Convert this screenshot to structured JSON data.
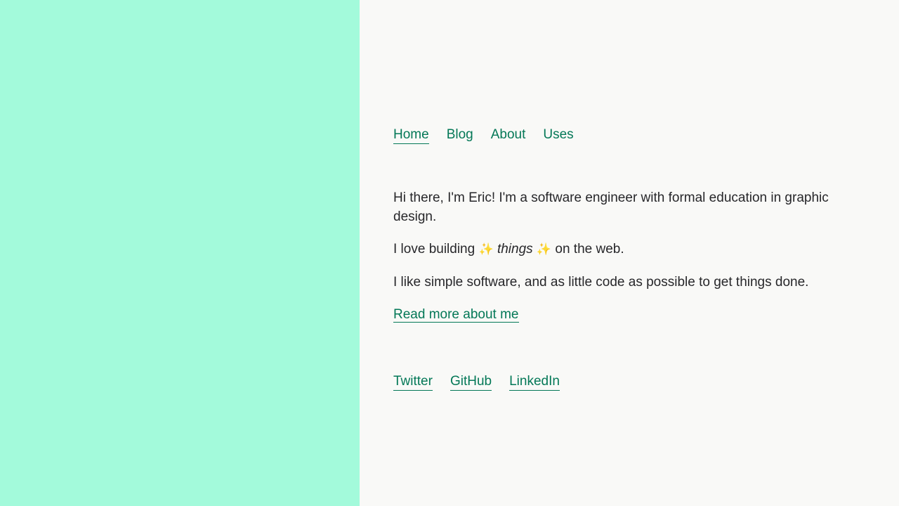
{
  "colors": {
    "left_panel": "#a3fadb",
    "page_bg": "#f9f9f7",
    "link": "#047857",
    "text": "#27272a",
    "sparkle": "#f6a821"
  },
  "nav": {
    "items": [
      {
        "label": "Home",
        "active": true
      },
      {
        "label": "Blog",
        "active": false
      },
      {
        "label": "About",
        "active": false
      },
      {
        "label": "Uses",
        "active": false
      }
    ]
  },
  "intro": {
    "p1": "Hi there, I'm Eric! I'm a software engineer with formal education in graphic design.",
    "p2_before": "I love building",
    "p2_sparkle": "✨",
    "p2_emphasis": "things",
    "p2_after": "on the web.",
    "p3": "I like simple software, and as little code as possible to get things done.",
    "read_more": "Read more about me"
  },
  "social": {
    "items": [
      "Twitter",
      "GitHub",
      "LinkedIn"
    ]
  }
}
